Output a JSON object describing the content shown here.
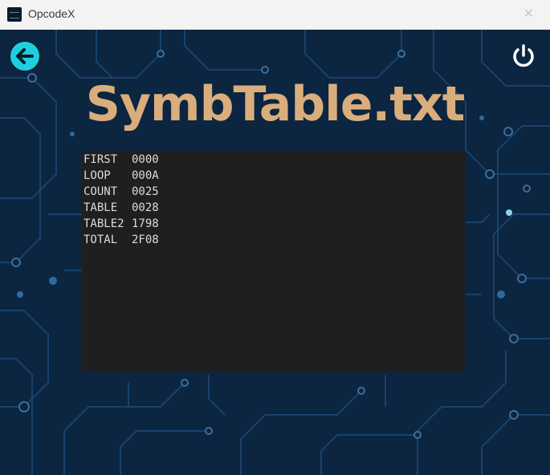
{
  "window": {
    "title": "OpcodeX",
    "app_icon": "opcodex-app-icon",
    "close_icon": "close-icon",
    "close_label": "✕"
  },
  "toolbar": {
    "back_icon": "arrow-left-icon",
    "power_icon": "power-icon"
  },
  "page": {
    "heading": "SymbTable.txt"
  },
  "symbol_table": {
    "rows": [
      {
        "symbol": "FIRST",
        "address": "0000"
      },
      {
        "symbol": "LOOP",
        "address": "000A"
      },
      {
        "symbol": "COUNT",
        "address": "0025"
      },
      {
        "symbol": "TABLE",
        "address": "0028"
      },
      {
        "symbol": "TABLE2",
        "address": "1798"
      },
      {
        "symbol": "TOTAL",
        "address": "2F08"
      }
    ]
  },
  "colors": {
    "background": "#0c2540",
    "heading": "#d9ad7c",
    "panel": "#1f1f1f",
    "text": "#dcdcdc",
    "back_button": "#1ecfe0"
  }
}
